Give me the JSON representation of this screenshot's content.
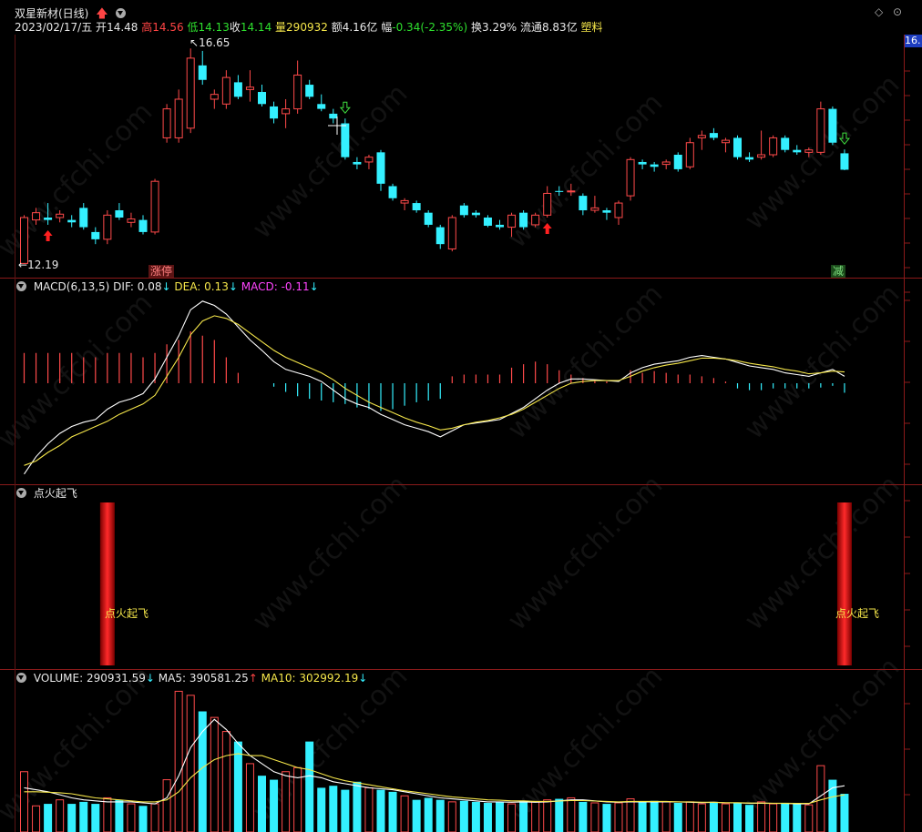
{
  "header": {
    "stock_name": "双星新材(日线)",
    "date": "2023/02/17/五",
    "open_label": "开",
    "open": "14.48",
    "high_label": "高",
    "high": "14.56",
    "low_label": "低",
    "low": "14.13",
    "close_label": "收",
    "close": "14.14",
    "volume_label": "量",
    "volume": "290932",
    "amount_label": "额",
    "amount": "4.16亿",
    "change_label": "幅",
    "change": "-0.34(-2.35%)",
    "turnover_label": "换",
    "turnover": "3.29%",
    "float_label": "流通",
    "float": "8.83亿",
    "sector": "塑料",
    "price_tag": "16."
  },
  "price_panel": {
    "high_marker": "16.65",
    "low_marker": "12.19",
    "tag_zhangting": "涨停",
    "tag_jian": "减"
  },
  "macd_panel": {
    "title": "MACD(6,13,5)",
    "dif_label": "DIF:",
    "dif": "0.08",
    "dea_label": "DEA:",
    "dea": "0.13",
    "macd_label": "MACD:",
    "macd": "-0.11"
  },
  "signal_panel": {
    "title": "点火起飞",
    "signal_text": "点火起飞"
  },
  "volume_panel": {
    "title": "VOLUME:",
    "volume": "290931.59",
    "ma5_label": "MA5:",
    "ma5": "390581.25",
    "ma10_label": "MA10:",
    "ma10": "302992.19"
  },
  "watermark": "www.cfchi.com",
  "colors": {
    "up": "#ff4a4a",
    "down": "#34f0ff",
    "dif": "#ffffff",
    "dea": "#f5e64a",
    "grid": "#8b1a1a"
  },
  "chart_data": {
    "type": "candlestick",
    "price_range": [
      12.0,
      16.9
    ],
    "candles": [
      {
        "o": 12.2,
        "h": 13.2,
        "l": 12.19,
        "c": 13.15
      },
      {
        "o": 13.1,
        "h": 13.35,
        "l": 13.0,
        "c": 13.25
      },
      {
        "o": 13.15,
        "h": 13.45,
        "l": 13.0,
        "c": 13.1
      },
      {
        "o": 13.15,
        "h": 13.3,
        "l": 13.05,
        "c": 13.22
      },
      {
        "o": 13.1,
        "h": 13.2,
        "l": 12.95,
        "c": 13.05
      },
      {
        "o": 13.35,
        "h": 13.45,
        "l": 12.9,
        "c": 12.95
      },
      {
        "o": 12.85,
        "h": 12.95,
        "l": 12.6,
        "c": 12.7
      },
      {
        "o": 12.7,
        "h": 13.3,
        "l": 12.6,
        "c": 13.2
      },
      {
        "o": 13.3,
        "h": 13.45,
        "l": 13.1,
        "c": 13.15
      },
      {
        "o": 13.05,
        "h": 13.25,
        "l": 12.95,
        "c": 13.12
      },
      {
        "o": 13.1,
        "h": 13.2,
        "l": 12.8,
        "c": 12.85
      },
      {
        "o": 12.85,
        "h": 13.95,
        "l": 12.8,
        "c": 13.9
      },
      {
        "o": 14.8,
        "h": 15.5,
        "l": 14.7,
        "c": 15.4
      },
      {
        "o": 14.8,
        "h": 15.8,
        "l": 14.7,
        "c": 15.6
      },
      {
        "o": 15.0,
        "h": 16.65,
        "l": 14.9,
        "c": 16.45
      },
      {
        "o": 16.3,
        "h": 16.6,
        "l": 15.9,
        "c": 16.0
      },
      {
        "o": 15.6,
        "h": 15.8,
        "l": 15.4,
        "c": 15.7
      },
      {
        "o": 15.5,
        "h": 16.2,
        "l": 15.4,
        "c": 16.05
      },
      {
        "o": 15.95,
        "h": 16.1,
        "l": 15.6,
        "c": 15.65
      },
      {
        "o": 15.8,
        "h": 16.2,
        "l": 15.55,
        "c": 15.85
      },
      {
        "o": 15.75,
        "h": 15.9,
        "l": 15.45,
        "c": 15.5
      },
      {
        "o": 15.45,
        "h": 15.55,
        "l": 15.1,
        "c": 15.2
      },
      {
        "o": 15.3,
        "h": 15.6,
        "l": 15.0,
        "c": 15.4
      },
      {
        "o": 15.4,
        "h": 16.4,
        "l": 15.3,
        "c": 16.1
      },
      {
        "o": 15.9,
        "h": 16.0,
        "l": 15.6,
        "c": 15.65
      },
      {
        "o": 15.5,
        "h": 15.7,
        "l": 15.35,
        "c": 15.4
      },
      {
        "o": 15.3,
        "h": 15.4,
        "l": 15.1,
        "c": 15.2
      },
      {
        "o": 15.1,
        "h": 15.2,
        "l": 14.35,
        "c": 14.4
      },
      {
        "o": 14.3,
        "h": 14.4,
        "l": 14.15,
        "c": 14.25
      },
      {
        "o": 14.3,
        "h": 14.45,
        "l": 14.15,
        "c": 14.4
      },
      {
        "o": 14.5,
        "h": 14.55,
        "l": 13.7,
        "c": 13.85
      },
      {
        "o": 13.8,
        "h": 13.85,
        "l": 13.5,
        "c": 13.55
      },
      {
        "o": 13.45,
        "h": 13.55,
        "l": 13.3,
        "c": 13.5
      },
      {
        "o": 13.45,
        "h": 13.5,
        "l": 13.25,
        "c": 13.3
      },
      {
        "o": 13.25,
        "h": 13.3,
        "l": 12.95,
        "c": 13.0
      },
      {
        "o": 12.95,
        "h": 13.0,
        "l": 12.5,
        "c": 12.6
      },
      {
        "o": 12.5,
        "h": 13.2,
        "l": 12.45,
        "c": 13.15
      },
      {
        "o": 13.4,
        "h": 13.45,
        "l": 13.15,
        "c": 13.2
      },
      {
        "o": 13.25,
        "h": 13.3,
        "l": 13.15,
        "c": 13.2
      },
      {
        "o": 13.15,
        "h": 13.2,
        "l": 12.95,
        "c": 12.98
      },
      {
        "o": 13.0,
        "h": 13.1,
        "l": 12.9,
        "c": 12.95
      },
      {
        "o": 12.95,
        "h": 13.25,
        "l": 12.75,
        "c": 13.2
      },
      {
        "o": 13.25,
        "h": 13.3,
        "l": 12.9,
        "c": 12.95
      },
      {
        "o": 13.0,
        "h": 13.25,
        "l": 12.95,
        "c": 13.2
      },
      {
        "o": 13.2,
        "h": 13.8,
        "l": 13.15,
        "c": 13.65
      },
      {
        "o": 13.7,
        "h": 13.8,
        "l": 13.6,
        "c": 13.68
      },
      {
        "o": 13.7,
        "h": 13.85,
        "l": 13.6,
        "c": 13.7
      },
      {
        "o": 13.6,
        "h": 13.65,
        "l": 13.2,
        "c": 13.3
      },
      {
        "o": 13.3,
        "h": 13.6,
        "l": 13.25,
        "c": 13.35
      },
      {
        "o": 13.3,
        "h": 13.35,
        "l": 13.1,
        "c": 13.25
      },
      {
        "o": 13.15,
        "h": 13.5,
        "l": 13.0,
        "c": 13.45
      },
      {
        "o": 13.6,
        "h": 14.4,
        "l": 13.5,
        "c": 14.35
      },
      {
        "o": 14.3,
        "h": 14.35,
        "l": 14.15,
        "c": 14.25
      },
      {
        "o": 14.25,
        "h": 14.3,
        "l": 14.1,
        "c": 14.2
      },
      {
        "o": 14.25,
        "h": 14.35,
        "l": 14.15,
        "c": 14.3
      },
      {
        "o": 14.45,
        "h": 14.5,
        "l": 14.1,
        "c": 14.15
      },
      {
        "o": 14.2,
        "h": 14.8,
        "l": 14.15,
        "c": 14.7
      },
      {
        "o": 14.8,
        "h": 14.95,
        "l": 14.55,
        "c": 14.85
      },
      {
        "o": 14.9,
        "h": 15.0,
        "l": 14.75,
        "c": 14.8
      },
      {
        "o": 14.7,
        "h": 14.8,
        "l": 14.5,
        "c": 14.75
      },
      {
        "o": 14.8,
        "h": 14.85,
        "l": 14.35,
        "c": 14.4
      },
      {
        "o": 14.4,
        "h": 14.5,
        "l": 14.3,
        "c": 14.35
      },
      {
        "o": 14.4,
        "h": 14.95,
        "l": 14.35,
        "c": 14.45
      },
      {
        "o": 14.45,
        "h": 14.85,
        "l": 14.4,
        "c": 14.8
      },
      {
        "o": 14.8,
        "h": 14.85,
        "l": 14.5,
        "c": 14.55
      },
      {
        "o": 14.55,
        "h": 14.65,
        "l": 14.45,
        "c": 14.5
      },
      {
        "o": 14.5,
        "h": 14.6,
        "l": 14.4,
        "c": 14.55
      },
      {
        "o": 14.5,
        "h": 15.55,
        "l": 14.45,
        "c": 15.4
      },
      {
        "o": 15.4,
        "h": 15.45,
        "l": 14.65,
        "c": 14.7
      },
      {
        "o": 14.48,
        "h": 14.56,
        "l": 14.13,
        "c": 14.14
      }
    ],
    "macd": {
      "dif": [
        -1.05,
        -0.85,
        -0.7,
        -0.58,
        -0.5,
        -0.45,
        -0.42,
        -0.3,
        -0.22,
        -0.18,
        -0.12,
        0.05,
        0.3,
        0.55,
        0.85,
        0.95,
        0.9,
        0.8,
        0.65,
        0.5,
        0.38,
        0.25,
        0.16,
        0.12,
        0.08,
        0.02,
        -0.08,
        -0.18,
        -0.24,
        -0.28,
        -0.36,
        -0.42,
        -0.48,
        -0.52,
        -0.56,
        -0.62,
        -0.55,
        -0.48,
        -0.46,
        -0.44,
        -0.42,
        -0.35,
        -0.28,
        -0.18,
        -0.08,
        0.0,
        0.05,
        0.05,
        0.04,
        0.03,
        0.02,
        0.12,
        0.18,
        0.22,
        0.24,
        0.26,
        0.3,
        0.32,
        0.3,
        0.28,
        0.24,
        0.2,
        0.18,
        0.16,
        0.12,
        0.1,
        0.08,
        0.12,
        0.16,
        0.08
      ],
      "dea": [
        -0.95,
        -0.9,
        -0.8,
        -0.72,
        -0.62,
        -0.56,
        -0.5,
        -0.44,
        -0.36,
        -0.3,
        -0.24,
        -0.14,
        0.08,
        0.3,
        0.56,
        0.72,
        0.78,
        0.75,
        0.68,
        0.58,
        0.48,
        0.38,
        0.3,
        0.24,
        0.18,
        0.12,
        0.04,
        -0.06,
        -0.14,
        -0.22,
        -0.28,
        -0.34,
        -0.4,
        -0.45,
        -0.49,
        -0.54,
        -0.52,
        -0.48,
        -0.45,
        -0.43,
        -0.4,
        -0.36,
        -0.3,
        -0.22,
        -0.14,
        -0.06,
        0.0,
        0.02,
        0.03,
        0.03,
        0.03,
        0.08,
        0.14,
        0.18,
        0.21,
        0.23,
        0.26,
        0.29,
        0.29,
        0.28,
        0.26,
        0.23,
        0.21,
        0.19,
        0.16,
        0.14,
        0.11,
        0.12,
        0.14,
        0.13
      ],
      "hist": [
        0.35,
        0.35,
        0.35,
        0.35,
        0.35,
        0.3,
        0.3,
        0.35,
        0.35,
        0.35,
        0.3,
        0.35,
        0.45,
        0.5,
        0.6,
        0.55,
        0.5,
        0.3,
        0.12,
        0,
        0,
        -0.04,
        -0.1,
        -0.15,
        -0.18,
        -0.2,
        -0.22,
        -0.24,
        -0.28,
        -0.3,
        -0.32,
        -0.3,
        -0.26,
        -0.22,
        -0.2,
        -0.18,
        0.08,
        0.1,
        0.1,
        0.1,
        0.1,
        0.18,
        0.22,
        0.25,
        0.22,
        0.15,
        0.1,
        0.06,
        0.04,
        0.02,
        0.0,
        0.15,
        0.12,
        0.14,
        0.12,
        0.1,
        0.1,
        0.08,
        0.06,
        0.02,
        -0.06,
        -0.08,
        -0.08,
        -0.06,
        -0.06,
        -0.06,
        -0.06,
        -0.05,
        -0.03,
        -0.11
      ]
    },
    "signals": [
      7,
      69
    ],
    "volume": {
      "values": [
        300,
        130,
        140,
        160,
        140,
        150,
        140,
        170,
        160,
        140,
        130,
        140,
        260,
        700,
        680,
        600,
        570,
        500,
        450,
        340,
        280,
        260,
        300,
        320,
        450,
        220,
        230,
        210,
        250,
        220,
        210,
        200,
        180,
        160,
        170,
        160,
        150,
        155,
        150,
        145,
        150,
        140,
        155,
        150,
        160,
        165,
        170,
        150,
        145,
        140,
        145,
        165,
        150,
        155,
        150,
        145,
        150,
        140,
        150,
        140,
        145,
        135,
        150,
        140,
        145,
        140,
        135,
        330,
        260,
        190
      ],
      "ma5": [
        220,
        210,
        200,
        185,
        170,
        160,
        155,
        150,
        150,
        150,
        145,
        140,
        170,
        280,
        420,
        500,
        560,
        510,
        440,
        380,
        340,
        300,
        280,
        270,
        280,
        270,
        250,
        240,
        230,
        220,
        215,
        210,
        200,
        190,
        180,
        170,
        165,
        160,
        155,
        150,
        150,
        148,
        150,
        148,
        150,
        155,
        160,
        160,
        155,
        150,
        148,
        150,
        150,
        150,
        150,
        150,
        148,
        146,
        148,
        145,
        145,
        143,
        143,
        142,
        142,
        140,
        140,
        180,
        220,
        230
      ],
      "ma10": [
        200,
        200,
        198,
        195,
        190,
        180,
        170,
        165,
        160,
        155,
        150,
        150,
        160,
        200,
        270,
        320,
        360,
        380,
        390,
        380,
        380,
        360,
        340,
        320,
        310,
        290,
        270,
        255,
        245,
        235,
        225,
        215,
        205,
        198,
        190,
        182,
        175,
        170,
        165,
        160,
        158,
        155,
        155,
        152,
        152,
        154,
        156,
        156,
        154,
        152,
        150,
        152,
        152,
        152,
        152,
        150,
        150,
        148,
        148,
        146,
        146,
        144,
        144,
        143,
        143,
        142,
        142,
        160,
        175,
        185
      ]
    }
  }
}
